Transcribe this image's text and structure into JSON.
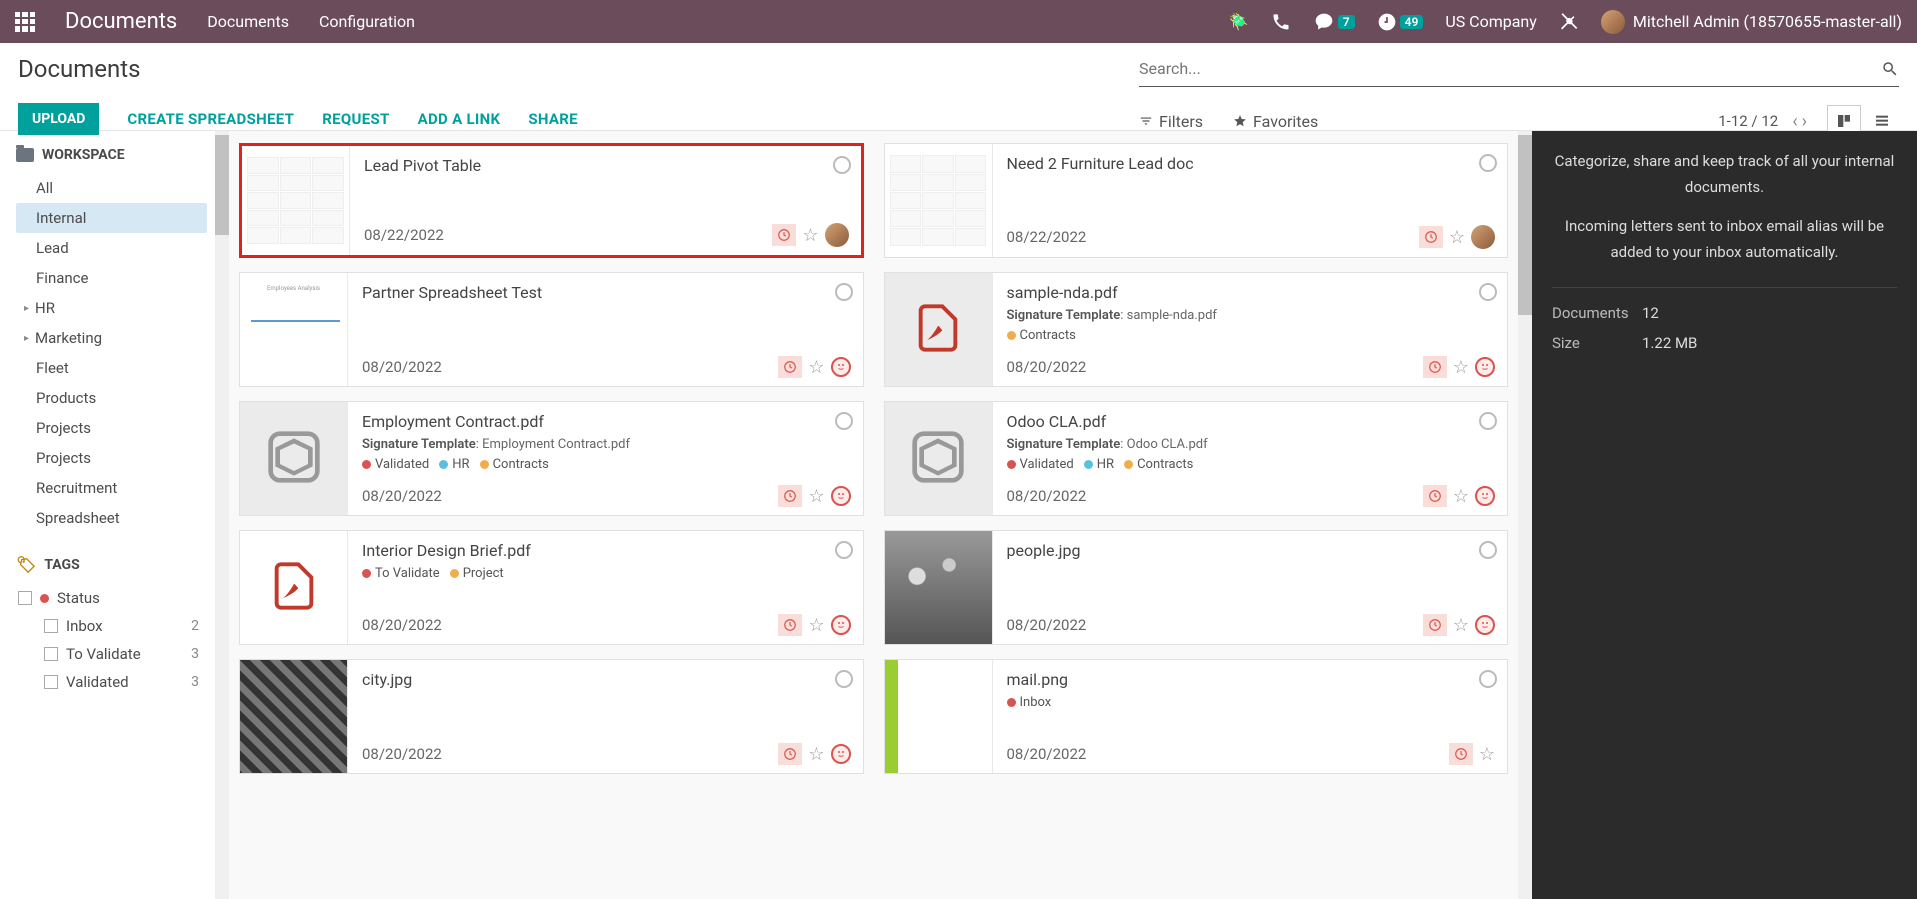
{
  "navbar": {
    "brand": "Documents",
    "links": [
      "Documents",
      "Configuration"
    ],
    "chat_count": "7",
    "activity_count": "49",
    "company": "US Company",
    "user": "Mitchell Admin (18570655-master-all)"
  },
  "control": {
    "title": "Documents",
    "upload": "UPLOAD",
    "create_spreadsheet": "CREATE SPREADSHEET",
    "request": "REQUEST",
    "add_link": "ADD A LINK",
    "share": "SHARE",
    "search_placeholder": "Search...",
    "filters": "Filters",
    "favorites": "Favorites",
    "pager": "1-12 / 12"
  },
  "sidebar": {
    "workspace_label": "WORKSPACE",
    "items": [
      {
        "label": "All"
      },
      {
        "label": "Internal"
      },
      {
        "label": "Lead"
      },
      {
        "label": "Finance"
      },
      {
        "label": "HR"
      },
      {
        "label": "Marketing"
      },
      {
        "label": "Fleet"
      },
      {
        "label": "Products"
      },
      {
        "label": "Projects"
      },
      {
        "label": "Projects"
      },
      {
        "label": "Recruitment"
      },
      {
        "label": "Spreadsheet"
      }
    ],
    "tags_label": "TAGS",
    "tag_status": "Status",
    "tag_items": [
      {
        "label": "Inbox",
        "count": "2"
      },
      {
        "label": "To Validate",
        "count": "3"
      },
      {
        "label": "Validated",
        "count": "3"
      }
    ]
  },
  "cards_left": [
    {
      "title": "Lead Pivot Table",
      "date": "08/22/2022",
      "thumb": "sheet",
      "highlighted": true,
      "avatar": true
    },
    {
      "title": "Partner Spreadsheet Test",
      "date": "08/20/2022",
      "thumb": "chart",
      "smiley": true
    },
    {
      "title": "Employment Contract.pdf",
      "date": "08/20/2022",
      "thumb": "box",
      "meta_label": "Signature Template",
      "meta_value": ": Employment Contract.pdf",
      "tags": [
        {
          "c": "#d9534f",
          "t": "Validated"
        },
        {
          "c": "#5bc0de",
          "t": "HR"
        },
        {
          "c": "#f0ad4e",
          "t": "Contracts"
        }
      ],
      "smiley": true,
      "grey": true
    },
    {
      "title": "Interior Design Brief.pdf",
      "date": "08/20/2022",
      "thumb": "pdf",
      "tags": [
        {
          "c": "#d9534f",
          "t": "To Validate"
        },
        {
          "c": "#f0ad4e",
          "t": "Project"
        }
      ],
      "smiley": true
    },
    {
      "title": "city.jpg",
      "date": "08/20/2022",
      "thumb": "photo-city",
      "smiley": true
    }
  ],
  "cards_right": [
    {
      "title": "Need 2 Furniture Lead doc",
      "date": "08/22/2022",
      "thumb": "sheet",
      "avatar": true
    },
    {
      "title": "sample-nda.pdf",
      "date": "08/20/2022",
      "thumb": "pdf",
      "meta_label": "Signature Template",
      "meta_value": ": sample-nda.pdf",
      "tags": [
        {
          "c": "#f0ad4e",
          "t": "Contracts"
        }
      ],
      "smiley": true,
      "grey": true
    },
    {
      "title": "Odoo CLA.pdf",
      "date": "08/20/2022",
      "thumb": "box",
      "meta_label": "Signature Template",
      "meta_value": ": Odoo CLA.pdf",
      "tags": [
        {
          "c": "#d9534f",
          "t": "Validated"
        },
        {
          "c": "#5bc0de",
          "t": "HR"
        },
        {
          "c": "#f0ad4e",
          "t": "Contracts"
        }
      ],
      "smiley": true,
      "grey": true
    },
    {
      "title": "people.jpg",
      "date": "08/20/2022",
      "thumb": "photo-people",
      "smiley": true
    },
    {
      "title": "mail.png",
      "date": "08/20/2022",
      "thumb": "mail",
      "tags": [
        {
          "c": "#d9534f",
          "t": "Inbox"
        }
      ]
    }
  ],
  "info": {
    "text1": "Categorize, share and keep track of all your internal documents.",
    "text2": "Incoming letters sent to inbox email alias will be added to your inbox automatically.",
    "docs_label": "Documents",
    "docs_value": "12",
    "size_label": "Size",
    "size_value": "1.22 MB"
  }
}
